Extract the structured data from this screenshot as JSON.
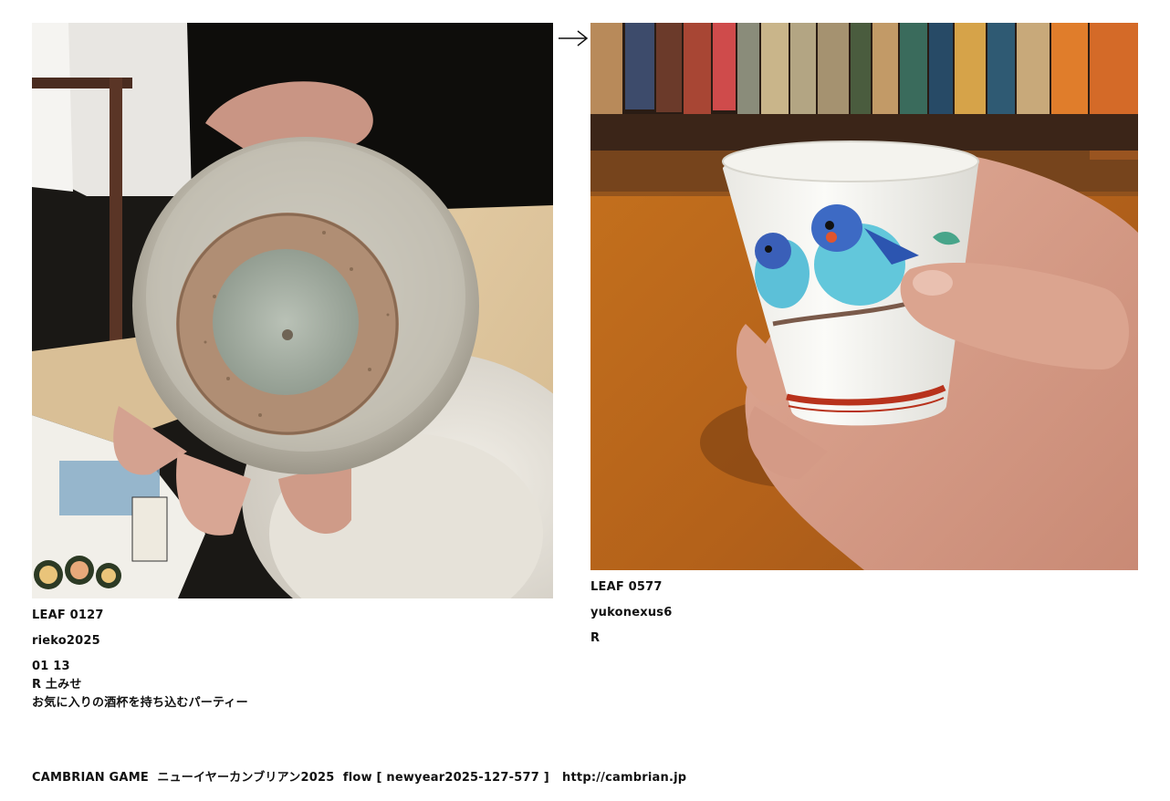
{
  "navigation": {
    "next_arrow": "→"
  },
  "left_entry": {
    "leaf_id": "LEAF 0127",
    "user": "rieko2025",
    "date": "01 13",
    "note_line1": "R 土みせ",
    "note_line2": "お気に入りの酒杯を持ち込むパーティー",
    "photo_subject": "ceramic-bowl-underside-icon"
  },
  "right_entry": {
    "leaf_id": "LEAF 0577",
    "user": "yukonexus6",
    "note": "R",
    "photo_subject": "porcelain-cup-with-birds-icon"
  },
  "footer": {
    "game": "CAMBRIAN GAME",
    "event": "ニューイヤーカンブリアン2025",
    "flow_label": "flow [ newyear2025-127-577 ]",
    "url": "http://cambrian.jp"
  },
  "colors": {
    "background": "#ffffff",
    "text": "#111111"
  }
}
